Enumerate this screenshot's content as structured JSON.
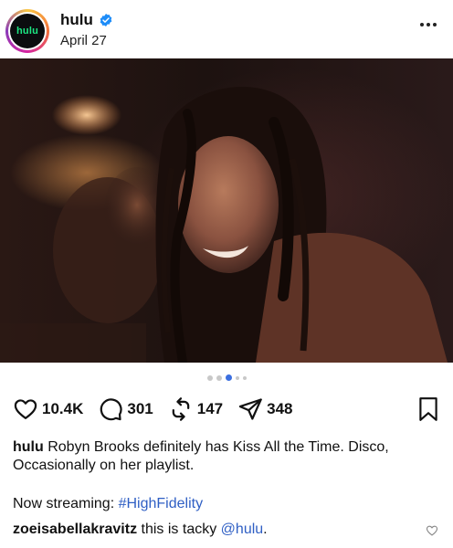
{
  "post": {
    "username": "hulu",
    "avatar_text": "hulu",
    "date": "April 27",
    "verified": true,
    "more_icon": "more-horizontal-icon"
  },
  "carousel": {
    "total": 5,
    "active_index": 2
  },
  "actions": {
    "likes": "10.4K",
    "comments": "301",
    "reposts": "147",
    "shares": "348"
  },
  "caption": {
    "username": "hulu",
    "text": "Robyn Brooks definitely has Kiss All the Time. Disco, Occasionally on her playlist."
  },
  "streaming": {
    "prefix": "Now streaming: ",
    "hashtag": "#HighFidelity"
  },
  "comment": {
    "username": "zoeisabellakravitz",
    "text": "this is tacky ",
    "mention": "@hulu",
    "suffix": "."
  },
  "colors": {
    "link": "#2f5fc4",
    "carousel_active": "#3b6fe0",
    "verified": "#1d8cf8",
    "hulu_green": "#1ce783"
  }
}
